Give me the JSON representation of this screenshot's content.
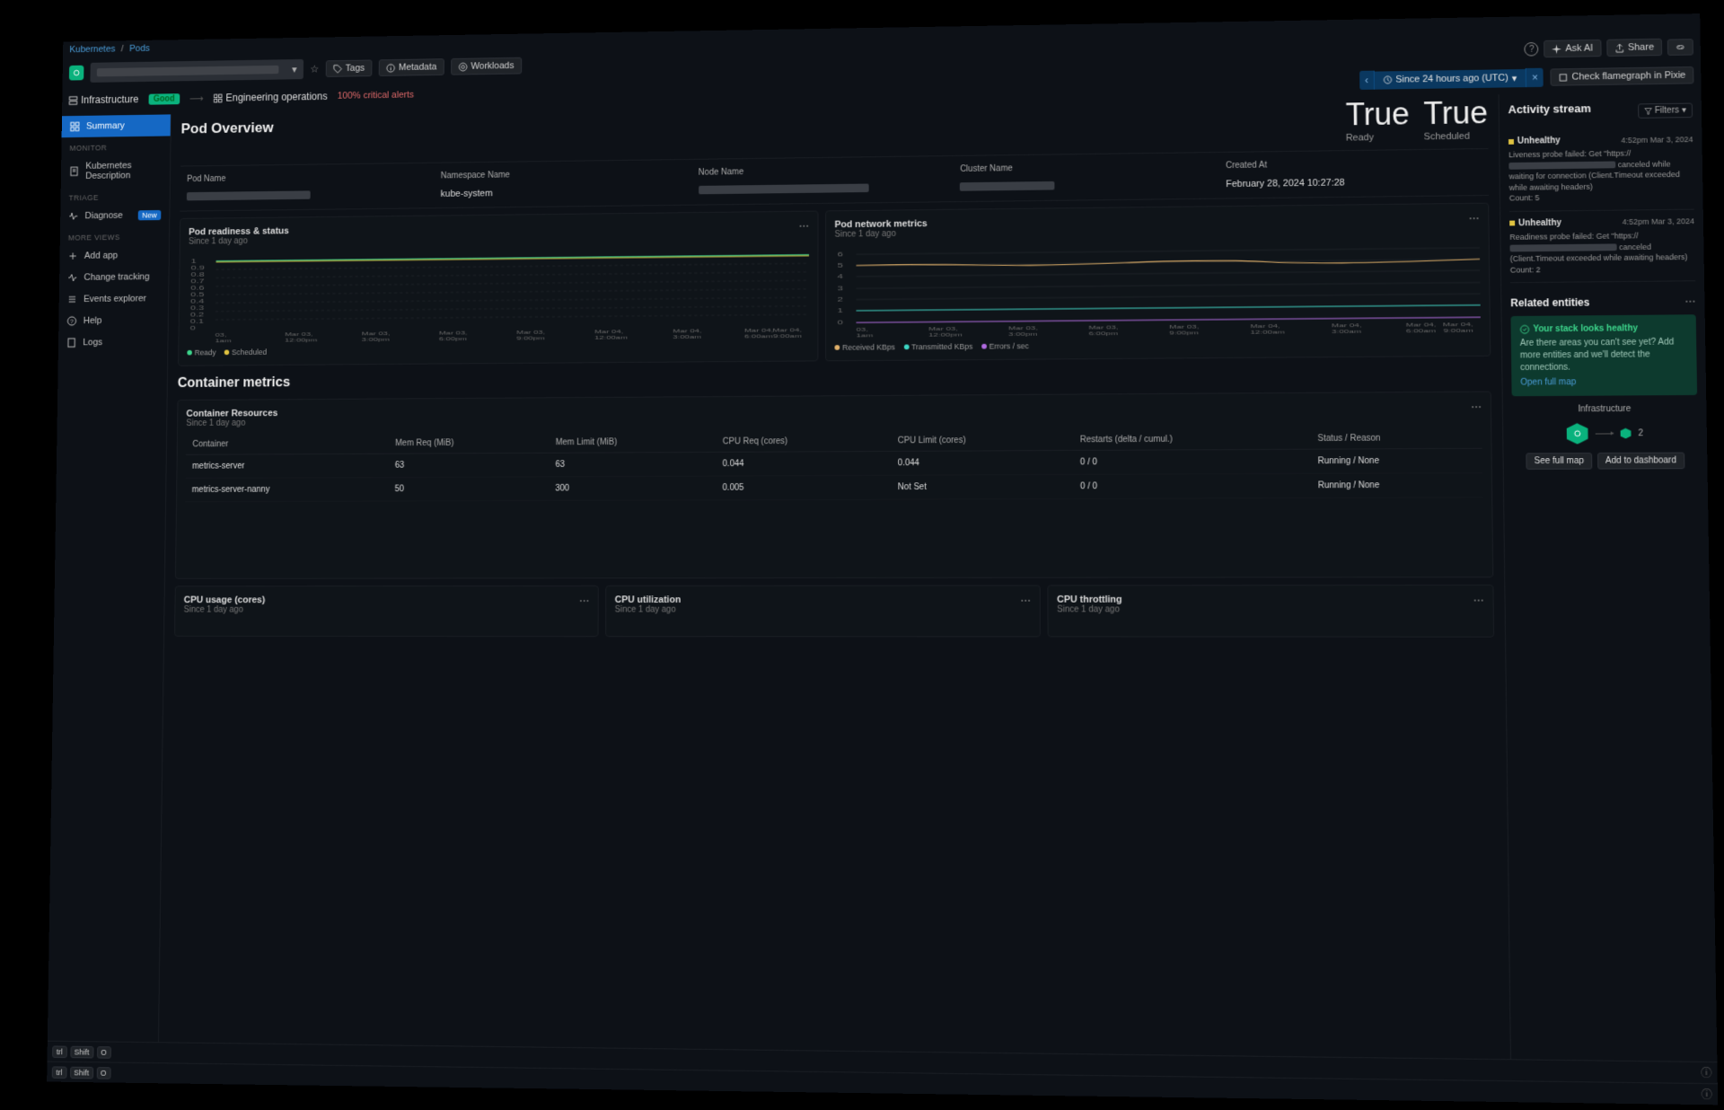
{
  "breadcrumb": {
    "root": "Kubernetes",
    "leaf": "Pods"
  },
  "header": {
    "tags_label": "Tags",
    "metadata_label": "Metadata",
    "workloads_label": "Workloads",
    "ask_ai": "Ask AI",
    "share": "Share"
  },
  "subheader": {
    "infra_label": "Infrastructure",
    "good_badge": "Good",
    "eng_ops": "Engineering operations",
    "crit_alerts": "100% critical alerts",
    "time_range": "Since 24 hours ago (UTC)",
    "flame_btn": "Check flamegraph in Pixie"
  },
  "sidebar": {
    "items": [
      {
        "label": "Summary",
        "icon": "grid",
        "active": true
      },
      {
        "heading": "MONITOR"
      },
      {
        "label": "Kubernetes Description",
        "icon": "doc"
      },
      {
        "heading": "TRIAGE"
      },
      {
        "label": "Diagnose",
        "icon": "pulse",
        "badge": "New"
      },
      {
        "heading": "MORE VIEWS"
      },
      {
        "label": "Add app",
        "icon": "plus"
      },
      {
        "label": "Change tracking",
        "icon": "activity"
      },
      {
        "label": "Events explorer",
        "icon": "list"
      },
      {
        "label": "Help",
        "icon": "help"
      },
      {
        "label": "Logs",
        "icon": "logs"
      }
    ]
  },
  "hero": {
    "title": "Pod Overview",
    "stats": [
      {
        "big": "True",
        "small": "Ready"
      },
      {
        "big": "True",
        "small": "Scheduled"
      }
    ]
  },
  "info": {
    "cells": [
      {
        "label": "Pod Name",
        "redacted": true
      },
      {
        "label": "Namespace Name",
        "value": "kube-system"
      },
      {
        "label": "Node Name",
        "redacted": true
      },
      {
        "label": "Cluster Name",
        "redacted": true
      },
      {
        "label": "Created At",
        "value": "February 28, 2024 10:27:28"
      }
    ]
  },
  "charts": {
    "readiness": {
      "title": "Pod readiness & status",
      "sub": "Since 1 day ago",
      "legend": [
        "Ready",
        "Scheduled"
      ]
    },
    "network": {
      "title": "Pod network metrics",
      "sub": "Since 1 day ago",
      "legend": [
        "Received KBps",
        "Transmitted KBps",
        "Errors / sec"
      ]
    },
    "x_ticks": [
      "03, 1am",
      "Mar 03, 12:00pm",
      "Mar 03, 3:00pm",
      "Mar 03, 6:00pm",
      "Mar 03, 9:00pm",
      "Mar 04, 12:00am",
      "Mar 04, 3:00am",
      "Mar 04, 6:00am",
      "Mar 04, 9:00am"
    ]
  },
  "container_section": {
    "title": "Container metrics",
    "resources_title": "Container Resources",
    "resources_sub": "Since 1 day ago",
    "columns": [
      "Container",
      "Mem Req (MiB)",
      "Mem Limit (MiB)",
      "CPU Req (cores)",
      "CPU Limit (cores)",
      "Restarts (delta / cumul.)",
      "Status / Reason"
    ],
    "rows": [
      [
        "metrics-server",
        "63",
        "63",
        "0.044",
        "0.044",
        "0 / 0",
        "Running / None"
      ],
      [
        "metrics-server-nanny",
        "50",
        "300",
        "0.005",
        "Not Set",
        "0 / 0",
        "Running / None"
      ]
    ]
  },
  "small_charts": [
    {
      "title": "CPU usage (cores)",
      "sub": "Since 1 day ago"
    },
    {
      "title": "CPU utilization",
      "sub": "Since 1 day ago"
    },
    {
      "title": "CPU throttling",
      "sub": "Since 1 day ago"
    }
  ],
  "activity": {
    "title": "Activity stream",
    "filters": "Filters",
    "events": [
      {
        "name": "Unhealthy",
        "time": "4:52pm Mar 3, 2024",
        "body_prefix": "Liveness probe failed: Get \"https://",
        "body_suffix": "canceled while waiting for connection (Client.Timeout exceeded while awaiting headers)",
        "count_label": "Count: 5"
      },
      {
        "name": "Unhealthy",
        "time": "4:52pm Mar 3, 2024",
        "body_prefix": "Readiness probe failed: Get \"https://",
        "body_suffix": "canceled (Client.Timeout exceeded while awaiting headers)",
        "count_label": "Count: 2"
      }
    ]
  },
  "related": {
    "title": "Related entities",
    "healthy": {
      "title": "Your stack looks healthy",
      "body": "Are there areas you can't see yet? Add more entities and we'll detect the connections.",
      "link": "Open full map"
    },
    "infra_label": "Infrastructure",
    "node_count": "2",
    "see_full": "See full map",
    "add_dash": "Add to dashboard"
  },
  "statusbar": {
    "keys": [
      "trl",
      "Shift",
      "O"
    ]
  },
  "chart_data": [
    {
      "type": "line",
      "title": "Pod readiness & status",
      "x": [
        "03 1am",
        "Mar 03 12pm",
        "Mar 03 3pm",
        "Mar 03 6pm",
        "Mar 03 9pm",
        "Mar 04 12am",
        "Mar 04 3am",
        "Mar 04 6am",
        "Mar 04 9am"
      ],
      "ylim": [
        0,
        1
      ],
      "yticks": [
        0,
        0.1,
        0.2,
        0.3,
        0.4,
        0.5,
        0.6,
        0.7,
        0.8,
        0.9,
        1
      ],
      "series": [
        {
          "name": "Ready",
          "values": [
            1,
            1,
            1,
            1,
            1,
            1,
            1,
            1,
            1
          ],
          "color": "#3dd68c"
        },
        {
          "name": "Scheduled",
          "values": [
            1,
            1,
            1,
            1,
            1,
            1,
            1,
            1,
            1
          ],
          "color": "#e0c341"
        }
      ]
    },
    {
      "type": "line",
      "title": "Pod network metrics",
      "x": [
        "03 1am",
        "Mar 03 12pm",
        "Mar 03 3pm",
        "Mar 03 6pm",
        "Mar 03 9pm",
        "Mar 04 12am",
        "Mar 04 3am",
        "Mar 04 6am",
        "Mar 04 9am"
      ],
      "ylim": [
        0,
        6
      ],
      "yticks": [
        0,
        1,
        2,
        3,
        4,
        5,
        6
      ],
      "series": [
        {
          "name": "Received KBps",
          "values": [
            5,
            5,
            5,
            5,
            5,
            5,
            5,
            5,
            5
          ],
          "color": "#e0b06a"
        },
        {
          "name": "Transmitted KBps",
          "values": [
            1,
            1,
            1,
            1,
            1,
            1,
            1,
            1,
            1
          ],
          "color": "#3dd6c4"
        },
        {
          "name": "Errors / sec",
          "values": [
            0,
            0,
            0,
            0,
            0,
            0,
            0,
            0,
            0
          ],
          "color": "#b06ae0"
        }
      ]
    }
  ]
}
